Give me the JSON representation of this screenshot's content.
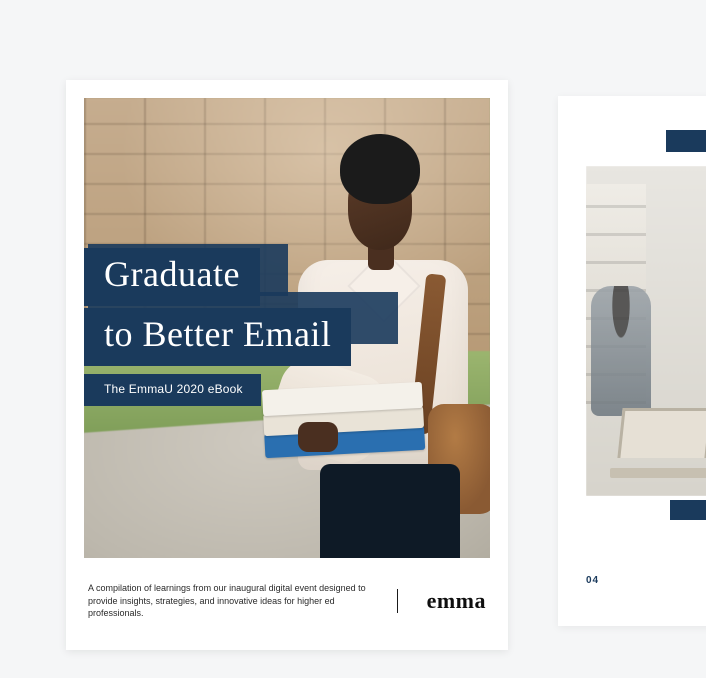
{
  "cover": {
    "title_line1": "Graduate",
    "title_line2": "to Better Email",
    "subtitle": "The EmmaU 2020 eBook",
    "blurb": "A compilation of learnings from our inaugural digital event designed to provide insights, strategies, and innovative ideas for higher ed professionals.",
    "brand": "emma"
  },
  "inner_page": {
    "page_number": "04"
  },
  "colors": {
    "navy": "#1a3a5c",
    "paper": "#ffffff",
    "canvas": "#f5f6f7"
  }
}
